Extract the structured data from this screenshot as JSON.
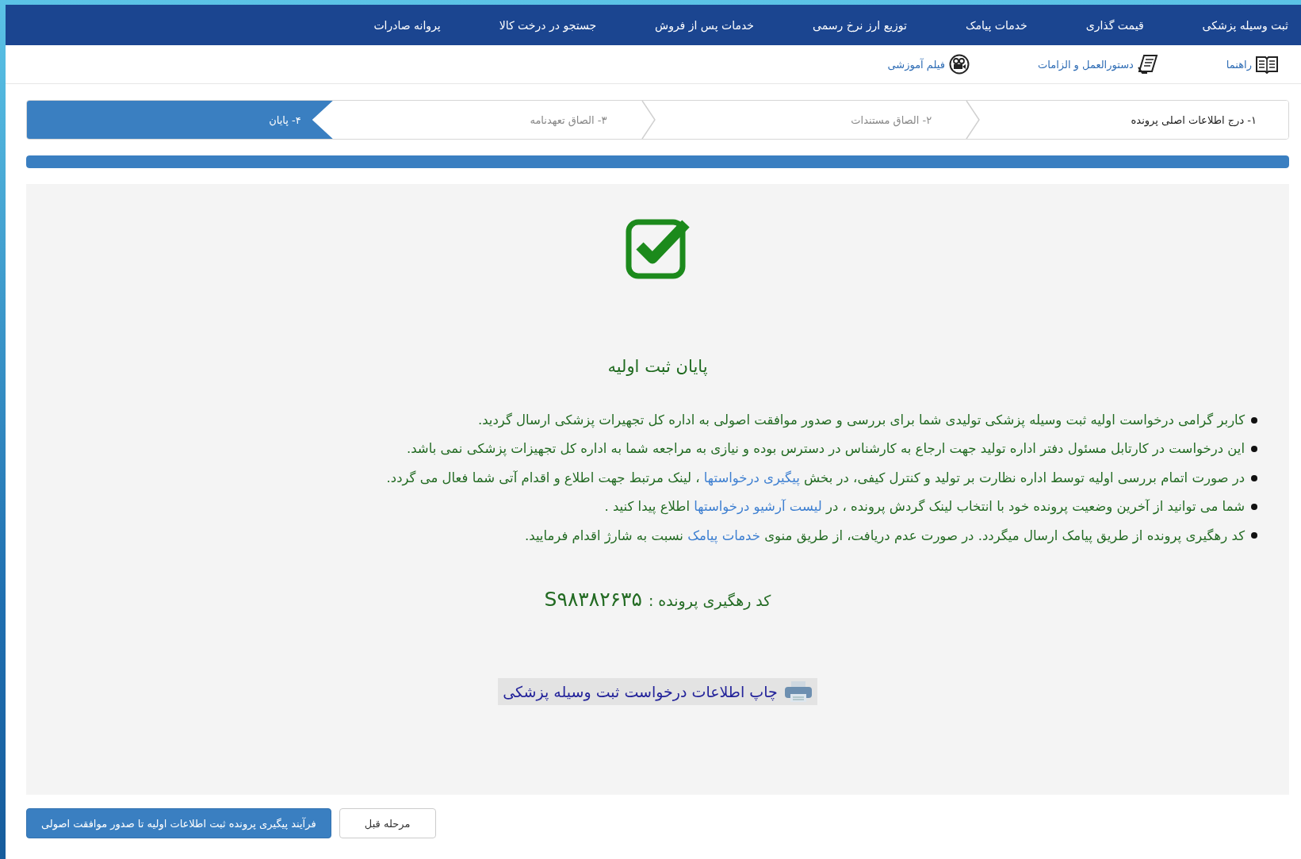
{
  "nav": {
    "items": [
      {
        "label": "ثبت وسیله پزشکی"
      },
      {
        "label": "قیمت گذاری"
      },
      {
        "label": "خدمات پیامک"
      },
      {
        "label": "توزیع ارز نرخ رسمی"
      },
      {
        "label": "خدمات پس از فروش"
      },
      {
        "label": "جستجو در درخت کالا"
      },
      {
        "label": "پروانه صادرات"
      }
    ]
  },
  "toolbar": {
    "items": [
      {
        "kind": "guide",
        "label": "راهنما"
      },
      {
        "kind": "rules",
        "label": "دستورالعمل و الزامات"
      },
      {
        "kind": "video",
        "label": "فیلم آموزشی"
      }
    ]
  },
  "steps": [
    {
      "label": "۱- درج اطلاعات اصلی پرونده",
      "selected": false,
      "done": true
    },
    {
      "label": "۲- الصاق مستندات",
      "selected": false,
      "done": false
    },
    {
      "label": "۳- الصاق تعهدنامه",
      "selected": false,
      "done": false
    },
    {
      "label": "۴- پایان",
      "selected": true,
      "done": false
    }
  ],
  "progress": {
    "level": 1
  },
  "result": {
    "title": "پایان ثبت اولیه",
    "bullets": [
      {
        "parts": [
          {
            "kind": "text",
            "text": "کاربر گرامی درخواست اولیه ثبت وسیله پزشکی تولیدی شما برای بررسی و صدور موافقت اصولی به اداره کل تجهیرات پزشکی ارسال گردید."
          }
        ]
      },
      {
        "parts": [
          {
            "kind": "text",
            "text": "این درخواست در کارتابل مسئول دفتر اداره تولید جهت ارجاع به کارشناس در دسترس بوده و نیازی به مراجعه شما به اداره کل تجهیزات پزشکی نمی باشد."
          }
        ]
      },
      {
        "parts": [
          {
            "kind": "text",
            "text": "در صورت اتمام بررسی اولیه توسط اداره نظارت بر تولید و کنترل کیفی، در بخش "
          },
          {
            "kind": "link",
            "text": "پیگیری درخواستها"
          },
          {
            "kind": "text",
            "text": " ، لینک مرتبط جهت اطلاع و اقدام آتی شما فعال می گردد."
          }
        ]
      },
      {
        "parts": [
          {
            "kind": "text",
            "text": "شما می توانید از آخرین وضعیت پرونده خود با انتخاب لینک گردش پرونده ، در "
          },
          {
            "kind": "link",
            "text": "لیست آرشیو درخواستها"
          },
          {
            "kind": "text",
            "text": " اطلاع پیدا کنید ."
          }
        ]
      },
      {
        "parts": [
          {
            "kind": "text",
            "text": "کد رهگیری پرونده از طریق پیامک ارسال میگردد. در صورت عدم دریافت، از طریق منوی "
          },
          {
            "kind": "link",
            "text": "خدمات پیامک"
          },
          {
            "kind": "text",
            "text": " نسبت به شارژ اقدام فرمایید."
          }
        ]
      }
    ],
    "tracking_label": "کد رهگیری پرونده :",
    "tracking_code": "S۹۸۳۸۲۶۳۵",
    "print_link": "چاپ اطلاعات درخواست ثبت وسیله پزشکی"
  },
  "buttons": [
    {
      "kind": "default",
      "label": "مرحله قبل"
    },
    {
      "kind": "primary",
      "label": "فرآیند پیگیری پرونده ثبت اطلاعات اولیه تا صدور موافقت اصولی"
    }
  ]
}
